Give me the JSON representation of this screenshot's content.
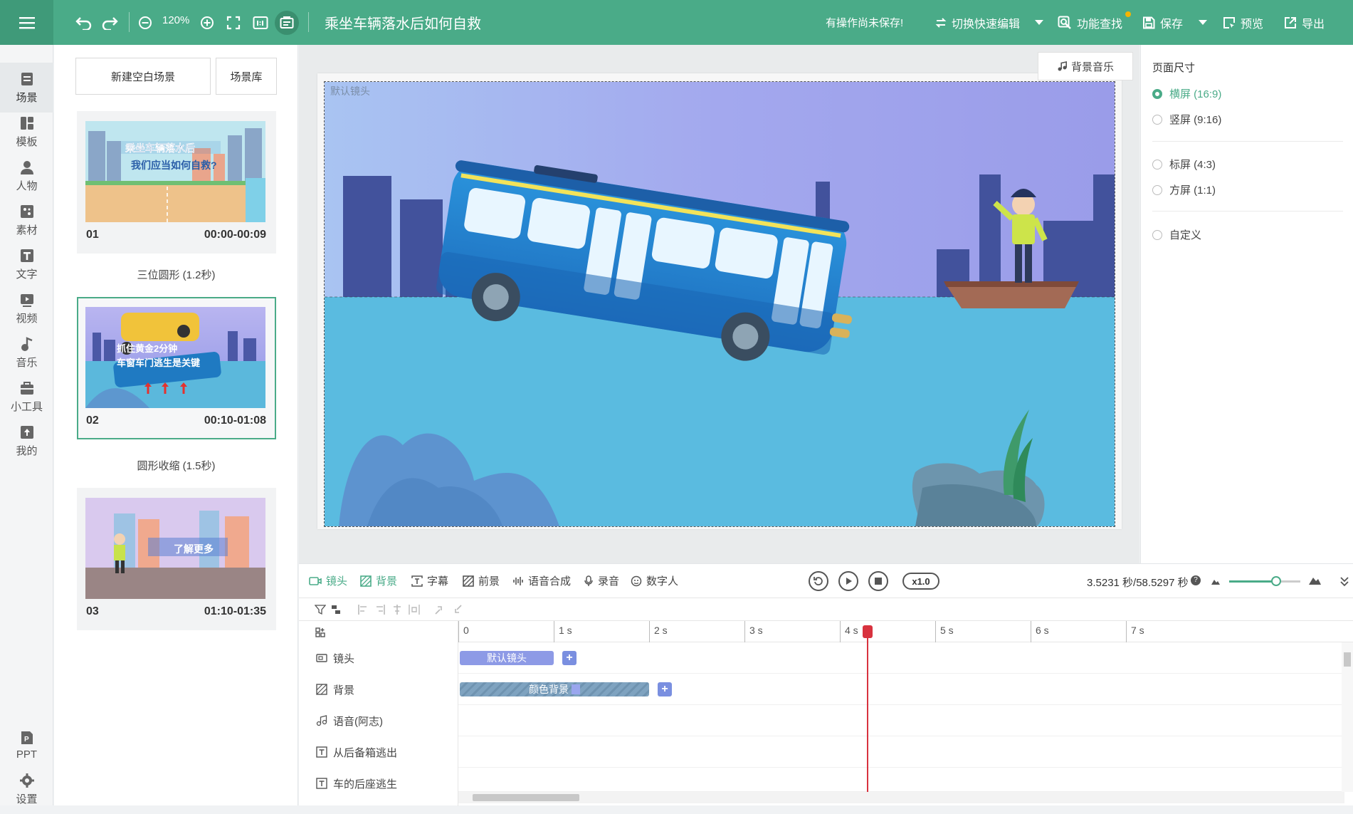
{
  "topbar": {
    "zoom": "120%",
    "doc_title": "乘坐车辆落水后如何自救",
    "unsaved_notice": "有操作尚未保存!",
    "quick_edit": "切换快速编辑",
    "feature_search": "功能查找",
    "save": "保存",
    "preview": "预览",
    "export": "导出",
    "brand_color": "#4aab88"
  },
  "leftnav": {
    "items": [
      {
        "label": "场景",
        "icon": "scene-icon"
      },
      {
        "label": "模板",
        "icon": "template-icon"
      },
      {
        "label": "人物",
        "icon": "person-icon"
      },
      {
        "label": "素材",
        "icon": "material-icon"
      },
      {
        "label": "文字",
        "icon": "text-icon"
      },
      {
        "label": "视频",
        "icon": "video-icon"
      },
      {
        "label": "音乐",
        "icon": "music-icon"
      },
      {
        "label": "小工具",
        "icon": "toolbox-icon"
      },
      {
        "label": "我的",
        "icon": "upload-icon"
      }
    ],
    "bottom": [
      {
        "label": "PPT",
        "icon": "ppt-icon"
      },
      {
        "label": "设置",
        "icon": "settings-icon"
      }
    ]
  },
  "scenes": {
    "new_blank": "新建空白场景",
    "library": "场景库",
    "cards": [
      {
        "num": "01",
        "time": "00:00-00:09",
        "thumb_text": [
          "乘坐车辆落水后",
          "我们应当如何自救?"
        ]
      },
      {
        "num": "02",
        "time": "00:10-01:08",
        "thumb_text": [
          "抓住黄金2分钟",
          "车窗车门逃生是关键"
        ]
      },
      {
        "num": "03",
        "time": "01:10-01:35",
        "thumb_text": [
          "了解更多"
        ]
      }
    ],
    "transitions": [
      "三位圆形 (1.2秒)",
      "圆形收缩 (1.5秒)"
    ]
  },
  "canvas": {
    "camera_label": "默认镜头",
    "bgm_button": "背景音乐"
  },
  "page_size": {
    "title": "页面尺寸",
    "options": [
      "横屏 (16:9)",
      "竖屏 (9:16)",
      "标屏 (4:3)",
      "方屏 (1:1)",
      "自定义"
    ],
    "selected": "横屏 (16:9)"
  },
  "timeline": {
    "tabs": [
      "镜头",
      "背景",
      "字幕",
      "前景",
      "语音合成",
      "录音",
      "数字人"
    ],
    "active_tab": "背景",
    "speed": "x1.0",
    "timecode": "3.5231 秒/58.5297 秒",
    "zoom_fraction": 0.66,
    "ruler": [
      "0",
      "1 s",
      "2 s",
      "3 s",
      "4 s",
      "5 s",
      "6 s",
      "7 s"
    ],
    "playhead_seconds": 3.52,
    "tracks": [
      {
        "label": "镜头",
        "icon": "camera-icon"
      },
      {
        "label": "背景",
        "icon": "background-icon"
      },
      {
        "label": "语音(阿志)",
        "icon": "music-note-icon"
      },
      {
        "label": "从后备箱逃出",
        "icon": "text-box-icon"
      },
      {
        "label": "车的后座逃生",
        "icon": "text-box-icon"
      }
    ],
    "clips": {
      "camera": {
        "label": "默认镜头",
        "start_s": 0,
        "end_s": 1.0,
        "color": "#8d9ae6"
      },
      "background": {
        "label": "颜色背景",
        "start_s": 0,
        "end_s": 2.0,
        "color": "#7fa3c0"
      }
    }
  }
}
